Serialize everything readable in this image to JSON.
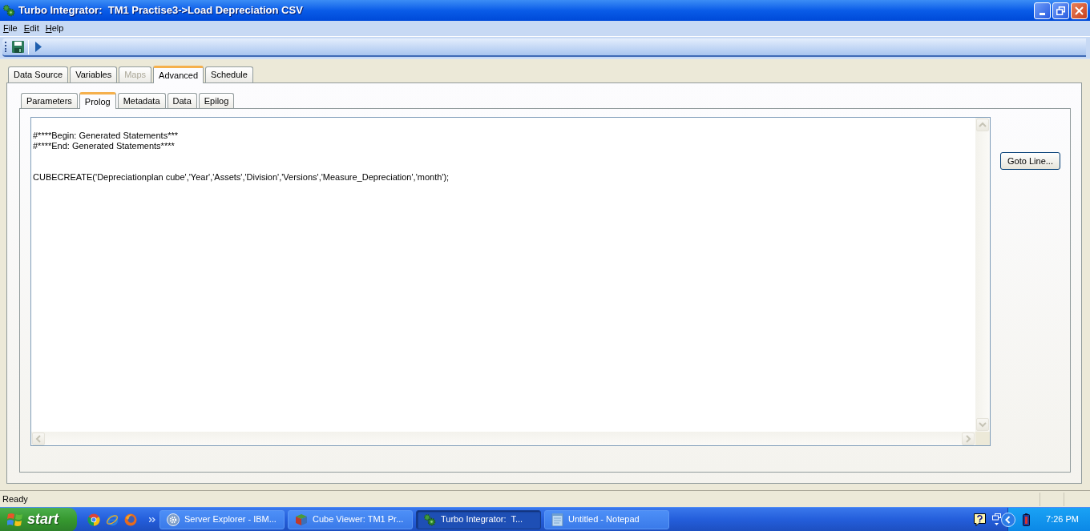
{
  "window": {
    "title": "Turbo Integrator:  TM1 Practise3->Load Depreciation CSV"
  },
  "menu": [
    {
      "label": "File"
    },
    {
      "label": "Edit"
    },
    {
      "label": "Help"
    }
  ],
  "tabs": [
    {
      "label": "Data Source",
      "selected": false,
      "disabled": false
    },
    {
      "label": "Variables",
      "selected": false,
      "disabled": false
    },
    {
      "label": "Maps",
      "selected": false,
      "disabled": true
    },
    {
      "label": "Advanced",
      "selected": true,
      "disabled": false
    },
    {
      "label": "Schedule",
      "selected": false,
      "disabled": false
    }
  ],
  "subtabs": [
    {
      "label": "Parameters",
      "selected": false
    },
    {
      "label": "Prolog",
      "selected": true
    },
    {
      "label": "Metadata",
      "selected": false
    },
    {
      "label": "Data",
      "selected": false
    },
    {
      "label": "Epilog",
      "selected": false
    }
  ],
  "editor": {
    "sections": [
      [
        "#****Begin: Generated Statements***",
        "#****End: Generated Statements****"
      ],
      [
        "CUBECREATE('Depreciationplan cube','Year','Assets','Division','Versions','Measure_Depreciation','month');"
      ]
    ]
  },
  "goto_button": {
    "label": "Goto Line..."
  },
  "status_bar": {
    "text": "Ready"
  },
  "taskbar": {
    "start": "start",
    "tasks": [
      {
        "label": "Server Explorer - IBM...",
        "kind": "server",
        "selected": false
      },
      {
        "label": "Cube Viewer: TM1 Pr...",
        "kind": "cube",
        "selected": false
      },
      {
        "label": "Turbo Integrator:  T...",
        "kind": "integrator",
        "selected": true
      },
      {
        "label": "Untitled - Notepad",
        "kind": "notepad",
        "selected": false
      }
    ],
    "clock": "7:26 PM"
  }
}
